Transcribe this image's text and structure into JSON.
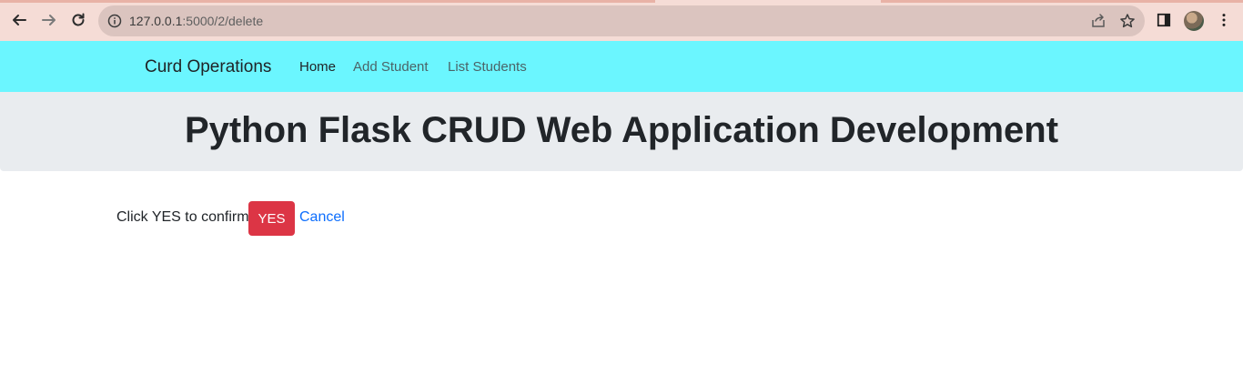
{
  "browser": {
    "url_host": "127.0.0.1",
    "url_path": ":5000/2/delete",
    "icons": [
      "back-arrow-icon",
      "forward-arrow-icon",
      "reload-icon",
      "info-icon",
      "share-icon",
      "star-icon",
      "side-panel-icon",
      "profile-avatar",
      "menu-dots-icon"
    ]
  },
  "navbar": {
    "brand": "Curd Operations",
    "links": [
      "Home",
      "Add Student",
      "List Students"
    ],
    "background": "#6bf6ff"
  },
  "hero": {
    "title": "Python Flask CRUD Web Application Development"
  },
  "confirm": {
    "text": "Click YES to confirm",
    "yes_label": "YES",
    "cancel_label": "Cancel",
    "yes_color": "#dc3545",
    "cancel_color": "#0d6efd"
  }
}
